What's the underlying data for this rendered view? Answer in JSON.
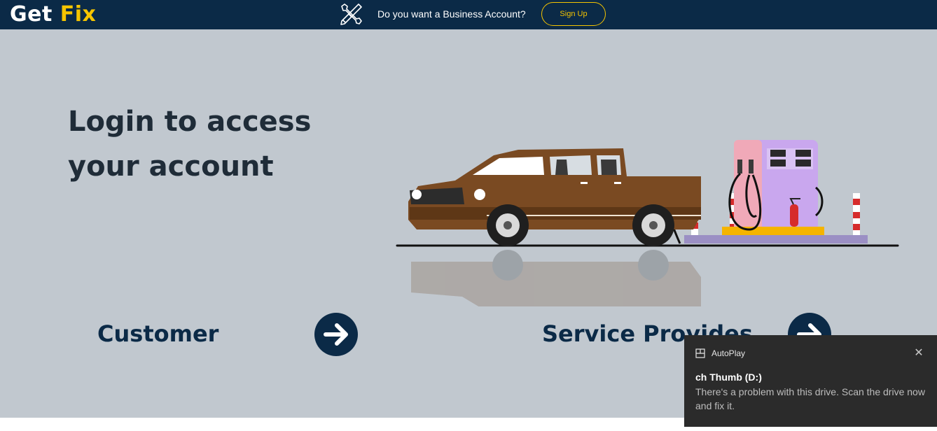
{
  "header": {
    "logo_part1": "Get",
    "logo_part2": "Fix",
    "promo_text": "Do you want a Business Account?",
    "signup_label": "Sign Up",
    "tools_icon": "tools-icon"
  },
  "hero": {
    "headline_line1": "Login to access",
    "headline_line2": "your account",
    "illustration": "pickup-truck-at-fuel-pump"
  },
  "roles": [
    {
      "label": "Customer",
      "icon": "arrow-right-circle-icon"
    },
    {
      "label": "Service Provides",
      "icon": "arrow-right-circle-icon"
    }
  ],
  "toast": {
    "app_name": "AutoPlay",
    "title": "ch Thumb (D:)",
    "body": "There's a problem with this drive.  Scan the drive now and fix it.",
    "close_icon": "close-icon"
  },
  "colors": {
    "navy": "#0b2a47",
    "accent_yellow": "#f5c400",
    "hero_bg": "#c1c8cf",
    "toast_bg": "#2b2b2b"
  }
}
